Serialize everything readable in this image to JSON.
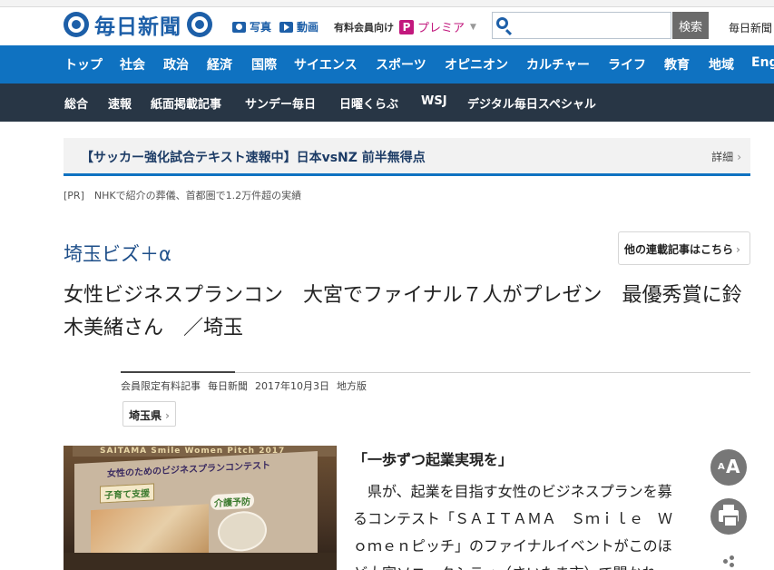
{
  "header": {
    "logo_text": "毎日新聞",
    "photo_link": "写真",
    "video_link": "動画",
    "member_label": "有料会員向け",
    "premier_badge": "P",
    "premier_label": "プレミア",
    "search_placeholder": "",
    "search_button": "検索",
    "site_link": "毎日新聞"
  },
  "nav_primary": [
    "トップ",
    "社会",
    "政治",
    "経済",
    "国際",
    "サイエンス",
    "スポーツ",
    "オピニオン",
    "カルチャー",
    "ライフ",
    "教育",
    "地域",
    "Eng"
  ],
  "nav_secondary": [
    "総合",
    "速報",
    "紙面掲載記事",
    "サンデー毎日",
    "日曜くらぶ",
    "WSJ",
    "デジタル毎日スペシャル"
  ],
  "breaking": {
    "headline": "【サッカー強化試合テキスト速報中】日本vsNZ 前半無得点",
    "detail": "詳細"
  },
  "pr_line": "[PR]　NHKで紹介の葬儀、首都圏で1.2万件超の実績",
  "series": {
    "label": "埼玉ビズ＋α",
    "more_button": "他の連載記事はこちら"
  },
  "article": {
    "title": "女性ビジネスプランコン　大宮でファイナル７人がプレゼン　最優秀賞に鈴木美緒さん　／埼玉",
    "meta_member": "会員限定有料記事",
    "meta_source": "毎日新聞",
    "meta_date": "2017年10月3日",
    "meta_section": "地方版",
    "tag": "埼玉県",
    "lead_heading": "「一歩ずつ起業実現を」",
    "body": "　県が、起業を目指す女性のビジネスプランを募るコンテスト「ＳＡＩＴＡＭＡ　Ｓｍｉｌｅ　Ｗｏｍｅｎピッチ」のファイナルイベントがこのほど大宮ソニックシティ（さいたま市）で開かれた。"
  },
  "photo": {
    "banner_text": "SAITAMA Smile Women Pitch 2017",
    "screen_title": "女性のためのビジネスプランコンテスト",
    "caption_left": "子育て支援",
    "caption_right": "介護予防"
  },
  "tools": {
    "font_small": "A",
    "font_big": "A"
  },
  "bookmarks": [
    "",
    ""
  ]
}
